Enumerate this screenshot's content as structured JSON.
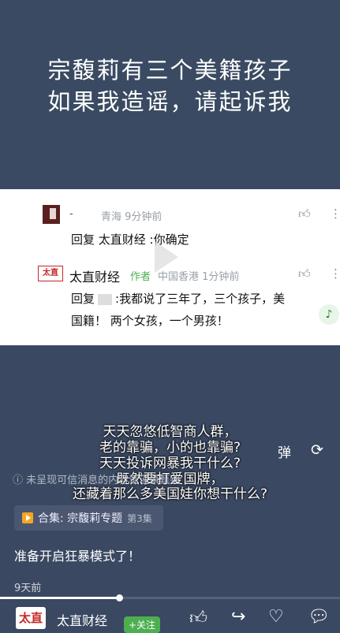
{
  "headline": {
    "line1": "宗馥莉有三个美籍孩子",
    "line2": "如果我造谣，请起诉我"
  },
  "comment_card": {
    "c1_name": "-",
    "c1_meta": "青海 9分钟前",
    "c1_text": "回复 太直财经 :你确定",
    "c2_logo": "太直",
    "c2_name": "太直财经",
    "c2_tag": "作者",
    "c2_meta": "中国香港 1分钟前",
    "c2_text_prefix": "回复",
    "c2_text": ":我都说了三年了，三个孩子，美",
    "c2_text2": "国籍！ 两个女孩，一个男孩！",
    "like_icon": "thumbs-up-icon",
    "more_icon": "vertical-dots-icon",
    "music_icon": "music-note-icon"
  },
  "overlay": {
    "line1": "天天忽悠低智商人群，",
    "line2": "老的靠骗，小的也靠骗?",
    "line3": "天天投诉网暴我干什么?",
    "line4": "既然要打爱国牌，",
    "line5": "还藏着那么多美国娃你想干什么?",
    "danmaku": "弹",
    "rotate_icon": "rotate-screen-icon"
  },
  "warning": "ⓘ 未呈现可信消息的内容请谨慎甄别",
  "collection": {
    "label": "合集: 宗馥莉专题",
    "episode": "第3集"
  },
  "caption": "准备开启狂暴模式了！",
  "date": "9天前",
  "progress_fraction": 0.35,
  "bottom": {
    "logo": "太直",
    "name": "太直财经",
    "follow": "+关注"
  }
}
